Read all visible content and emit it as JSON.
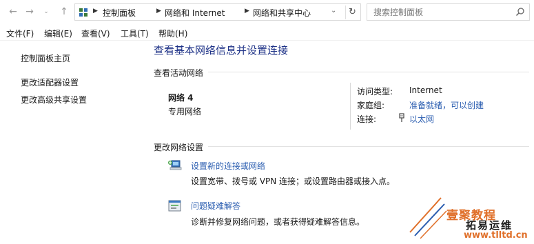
{
  "address_bar": {
    "crumbs": [
      "控制面板",
      "网络和 Internet",
      "网络和共享中心"
    ],
    "search_placeholder": "搜索控制面板"
  },
  "menu": [
    "文件(F)",
    "编辑(E)",
    "查看(V)",
    "工具(T)",
    "帮助(H)"
  ],
  "left_pane": {
    "links": [
      "控制面板主页",
      "更改适配器设置",
      "更改高级共享设置"
    ]
  },
  "main": {
    "title": "查看基本网络信息并设置连接",
    "active_networks_heading": "查看活动网络",
    "network": {
      "name": "网络  4",
      "type": "专用网络"
    },
    "properties": [
      {
        "label": "访问类型:",
        "value": "Internet"
      },
      {
        "label": "家庭组:",
        "value": "准备就绪，可以创建"
      },
      {
        "label": "连接:",
        "value": "以太网"
      }
    ],
    "change_settings_heading": "更改网络设置",
    "tasks": [
      {
        "link": "设置新的连接或网络",
        "description": "设置宽带、拨号或 VPN 连接；或设置路由器或接入点。",
        "icon": "network-setup-icon"
      },
      {
        "link": "问题疑难解答",
        "description": "诊断并修复网络问题，或者获得疑难解答信息。",
        "icon": "troubleshoot-icon"
      }
    ]
  },
  "watermark": {
    "line1": "壹聚教程",
    "line2": "拓易运维",
    "line3": "www.tlltd.cn",
    "color": "#e0702a"
  }
}
